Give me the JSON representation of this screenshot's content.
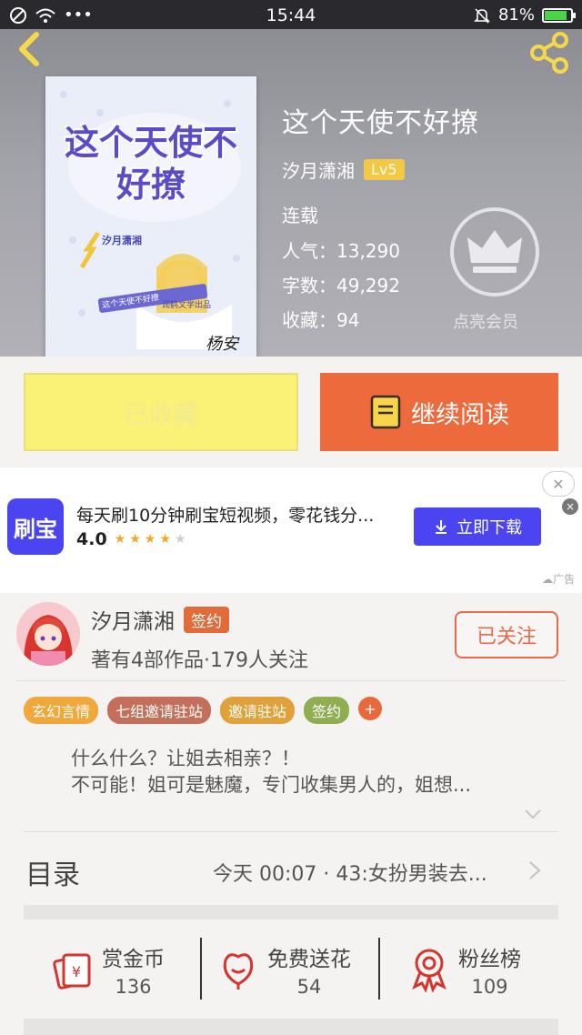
{
  "status_bar": {
    "time": "15:44",
    "battery": "81%"
  },
  "book": {
    "title": "这个天使不好撩",
    "author": "汐月潇湘",
    "level": "Lv5",
    "status": "连载",
    "popularity": "人气：13,290",
    "word_count": "字数：49,292",
    "favorites": "收藏：94",
    "vip_label": "点亮会员",
    "cover": {
      "title_art": "这个天使不好撩",
      "author_tag": "汐月潇湘",
      "tagline": "这个天使不好撩",
      "publisher": "润鹤文学出品",
      "signature": "杨安"
    }
  },
  "actions": {
    "favorited_label": "已收藏",
    "continue_label": "继续阅读"
  },
  "ad": {
    "logo_text": "刷宝",
    "text": "每天刷10分钟刷宝短视频，零花钱分...",
    "rating": "4.0",
    "rating_value": 4,
    "rating_max": 5,
    "download_label": "立即下载",
    "close_label": "✕",
    "ad_tag": "广告"
  },
  "author_card": {
    "name": "汐月潇湘",
    "badge": "签约",
    "works": "著有4部作品·179人关注",
    "follow_label": "已关注"
  },
  "tags": [
    {
      "label": "玄幻言情",
      "color": "#f1a83a"
    },
    {
      "label": "七组邀请驻站",
      "color": "#c46f5a"
    },
    {
      "label": "邀请驻站",
      "color": "#e0a03a"
    },
    {
      "label": "签约",
      "color": "#8fae52"
    }
  ],
  "intro": {
    "line1": "什么什么？让姐去相亲？！",
    "line2": "不可能！姐可是魅魔，专门收集男人的，姐想..."
  },
  "toc": {
    "label": "目录",
    "latest": "今天 00:07 · 43:女扮男装去..."
  },
  "stats": [
    {
      "label": "赏金币",
      "value": "136",
      "icon": "coin-envelope-icon"
    },
    {
      "label": "免费送花",
      "value": "54",
      "icon": "flower-icon"
    },
    {
      "label": "粉丝榜",
      "value": "109",
      "icon": "medal-icon"
    }
  ],
  "colors": {
    "accent": "#ec6a3b",
    "favorited_bg": "#faf277",
    "ad_brand": "#4a45f0",
    "stat_icon": "#d2362e"
  }
}
